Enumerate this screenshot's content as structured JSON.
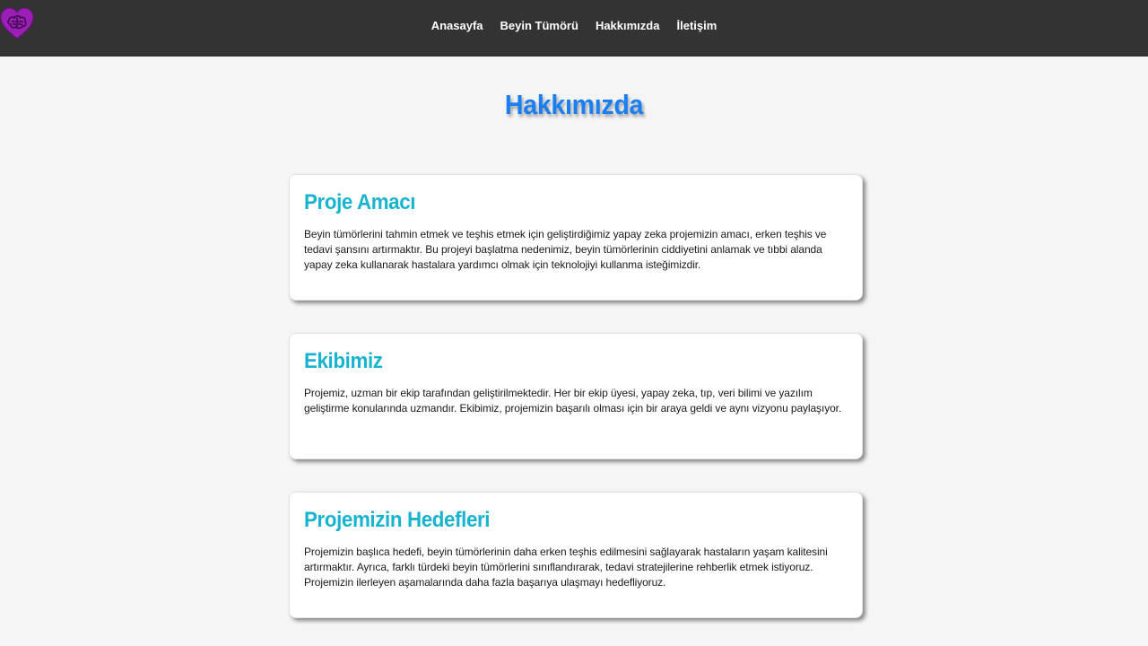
{
  "navbar": {
    "logo_icon": "heart-brain-logo-icon",
    "links": [
      "Anasayfa",
      "Beyin Tümörü",
      "Hakkımızda",
      "İletişim"
    ]
  },
  "page": {
    "title": "Hakkımızda"
  },
  "cards": [
    {
      "title": "Proje Amacı",
      "text": "Beyin tümörlerini tahmin etmek ve teşhis etmek için geliştirdiğimiz yapay zeka projemizin amacı, erken teşhis ve tedavi şansını artırmaktır. Bu projeyi başlatma nedenimiz, beyin tümörlerinin ciddiyetini anlamak ve tıbbi alanda yapay zeka kullanarak hastalara yardımcı olmak için teknolojiyi kullanma isteğimizdir."
    },
    {
      "title": "Ekibimiz",
      "text": "Projemiz, uzman bir ekip tarafından geliştirilmektedir. Her bir ekip üyesi, yapay zeka, tıp, veri bilimi ve yazılım geliştirme konularında uzmandır. Ekibimiz, projemizin başarılı olması için bir araya geldi ve aynı vizyonu paylaşıyor."
    },
    {
      "title": "Projemizin Hedefleri",
      "text": "Projemizin başlıca hedefi, beyin tümörlerinin daha erken teşhis edilmesini sağlayarak hastaların yaşam kalitesini artırmaktır. Ayrıca, farklı türdeki beyin tümörlerini sınıflandırarak, tedavi stratejilerine rehberlik etmek istiyoruz. Projemizin ilerleyen aşamalarında daha fazla başarıya ulaşmayı hedefliyoruz."
    }
  ],
  "colors": {
    "navbar_bg": "#333333",
    "page_bg": "#f5f5f5",
    "title": "#1a7ff2",
    "card_title": "#17b3cf",
    "logo": "#9b1fb5"
  }
}
